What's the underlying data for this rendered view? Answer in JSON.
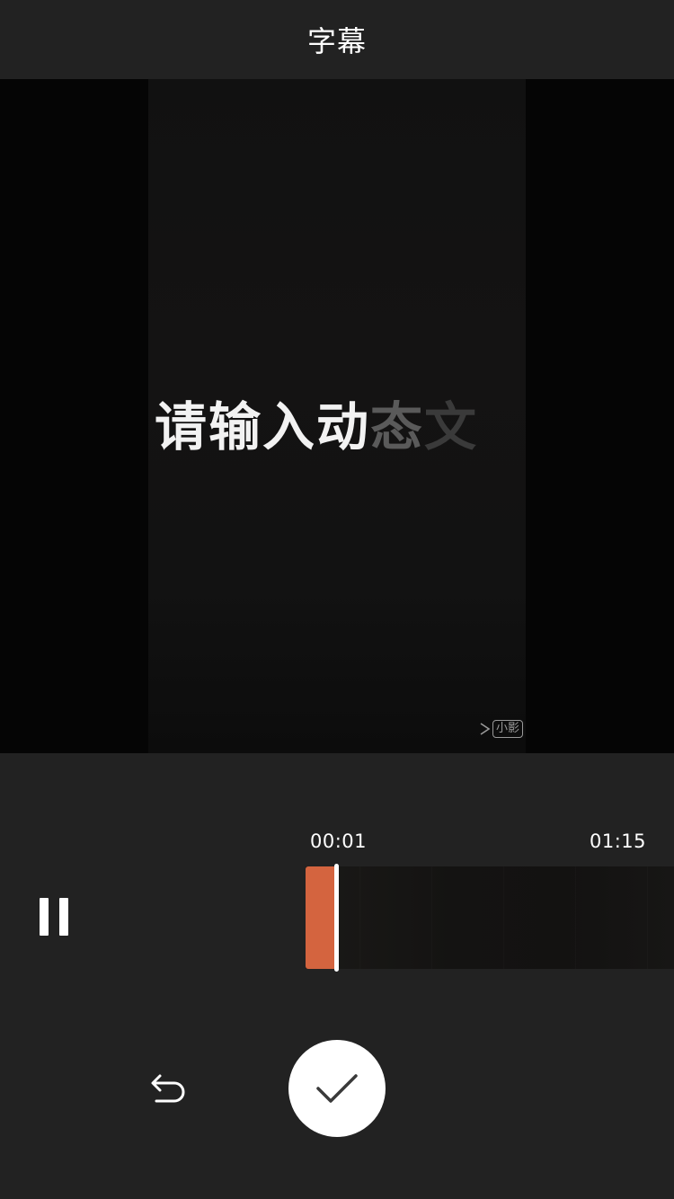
{
  "header": {
    "title": "字幕"
  },
  "preview": {
    "subtitle": {
      "bright": "请输入动",
      "dim1": "态",
      "dim2": "文"
    },
    "watermark": {
      "text": "小影"
    }
  },
  "timeline": {
    "current_time": "00:01",
    "total_time": "01:15",
    "clip_color": "#d4643f"
  },
  "controls": {
    "pause_icon": "pause-icon",
    "undo_icon": "undo-icon",
    "confirm_icon": "checkmark-icon"
  },
  "colors": {
    "background": "#222222",
    "preview_bg": "#050505",
    "accent": "#d4643f"
  }
}
